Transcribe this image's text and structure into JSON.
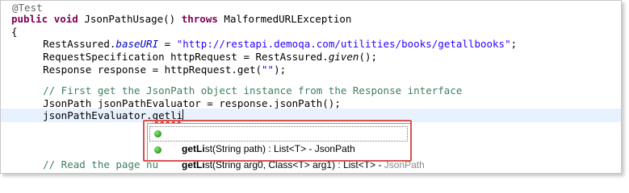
{
  "code": {
    "annotation": "@Test",
    "sig_kw1": "public",
    "sig_kw2": "void",
    "sig_name": " JsonPathUsage() ",
    "sig_kw3": "throws",
    "sig_rest": " MalformedURLException",
    "open_brace": "{",
    "l1_pre": "    RestAssured.",
    "l1_field": "baseURI",
    "l1_mid": " = ",
    "l1_str": "\"http://restapi.demoqa.com/utilities/books/getallbooks\"",
    "l1_end": ";",
    "l2_pre": "    RequestSpecification httpRequest = RestAssured.",
    "l2_it": "given",
    "l2_end": "();",
    "l3_pre": "    Response response = httpRequest.get(",
    "l3_str": "\"\"",
    "l3_end": ");",
    "l4_comment": "    // First get the JsonPath object instance from the Response interface",
    "l5": "    JsonPath jsonPathEvaluator = response.jsonPath();",
    "l6_pre": "    jsonPathEvaluator.",
    "l6_typed": "getli",
    "l7_comment": "    // Read the page nu"
  },
  "content_assist": {
    "proposals": [
      {
        "match": "getLi",
        "rest": "st(String path) : List<T> - JsonPath",
        "declaring": ""
      },
      {
        "match": "getLi",
        "rest": "st(String arg0, Class<T> arg1) : List<T> - ",
        "declaring": "JsonPath"
      }
    ],
    "icon": "public-method-icon"
  },
  "colors": {
    "keyword": "#7f0055",
    "string": "#2a00ff",
    "comment": "#3f7f5f",
    "field": "#0000c0",
    "highlight_box": "#d9534f"
  }
}
